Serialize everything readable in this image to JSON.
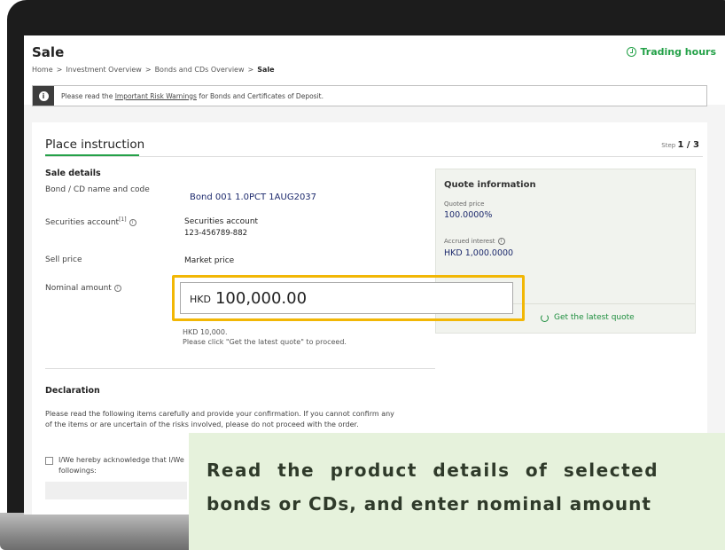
{
  "header": {
    "title": "Sale",
    "trading_hours": "Trading hours"
  },
  "breadcrumb": {
    "items": [
      "Home",
      ">",
      "Investment Overview",
      ">",
      "Bonds and CDs Overview",
      ">"
    ],
    "current": "Sale"
  },
  "warning": {
    "prefix": "Please read the ",
    "link": "Important Risk Warnings",
    "suffix": " for Bonds and Certificates of Deposit."
  },
  "step": {
    "title": "Place instruction",
    "label": "Step",
    "count": "1 / 3"
  },
  "sale_details": {
    "heading": "Sale details",
    "bond_label": "Bond / CD name and code",
    "bond_value": "Bond 001 1.0PCT 1AUG2037",
    "account_label": "Securities account",
    "account_sup": "[1]",
    "account_name": "Securities account",
    "account_number": "123-456789-882",
    "price_label": "Sell price",
    "price_value": "Market price",
    "nominal_label": "Nominal amount",
    "nominal_currency": "HKD",
    "nominal_value": "100,000.00",
    "hint_line1": "HKD 10,000.",
    "hint_line2": "Please click \"Get the latest quote\" to proceed."
  },
  "quote": {
    "title": "Quote information",
    "quoted_price_label": "Quoted price",
    "quoted_price_value": "100.0000%",
    "accrued_label": "Accrued interest",
    "accrued_value": "HKD 1,000.0000",
    "button": "Get the latest quote"
  },
  "declaration": {
    "heading": "Declaration",
    "text": "Please read the following items carefully and provide your confirmation. If you cannot confirm any of the items or are uncertain of the risks involved, please do not proceed with the order.",
    "checkbox_label": "I/We hereby acknowledge that I/We",
    "checkbox_label2": "followings:"
  },
  "caption": {
    "line1": "Read the product details of selected",
    "line2": "bonds or CDs, and enter nominal amount"
  },
  "colors": {
    "accent": "#24a148",
    "highlight": "#f2b705",
    "caption_bg": "#e6f2dc"
  }
}
